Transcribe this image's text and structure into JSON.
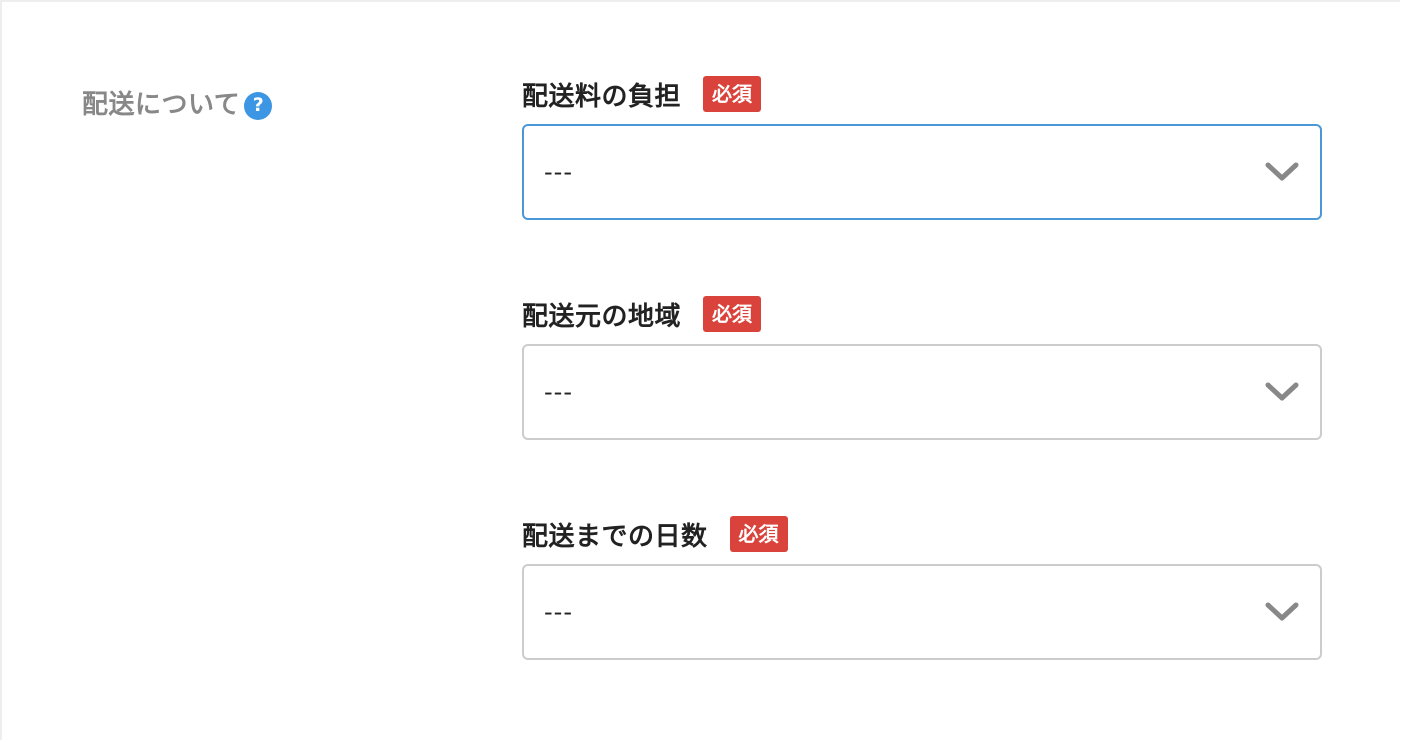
{
  "section": {
    "label": "配送について",
    "help_icon": "?"
  },
  "fields": [
    {
      "label": "配送料の負担",
      "badge": "必須",
      "value": "---",
      "icon": "chevron-down-icon"
    },
    {
      "label": "配送元の地域",
      "badge": "必須",
      "value": "---",
      "icon": "chevron-down-icon"
    },
    {
      "label": "配送までの日数",
      "badge": "必須",
      "value": "---",
      "icon": "chevron-down-icon"
    }
  ],
  "colors": {
    "required_badge": "#d9433b",
    "help_icon": "#3d96e3",
    "focused_border": "#4a98d8",
    "default_border": "#cccccc"
  }
}
